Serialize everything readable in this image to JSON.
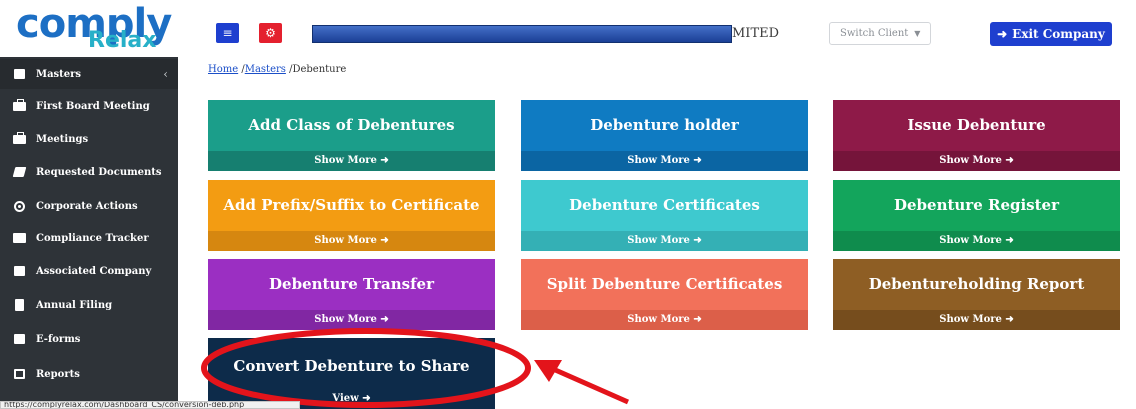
{
  "brand": {
    "logo_main": "comply",
    "logo_sub": "Relax"
  },
  "sidebar": {
    "items": [
      {
        "label": "Masters",
        "icon": "grid-icon",
        "caret": "‹"
      },
      {
        "label": "First Board Meeting",
        "icon": "briefcase-icon"
      },
      {
        "label": "Meetings",
        "icon": "briefcase-icon"
      },
      {
        "label": "Requested Documents",
        "icon": "folder-icon"
      },
      {
        "label": "Corporate Actions",
        "icon": "target-icon"
      },
      {
        "label": "Compliance Tracker",
        "icon": "list-icon"
      },
      {
        "label": "Associated Company",
        "icon": "building-icon"
      },
      {
        "label": "Annual Filing",
        "icon": "file-icon"
      },
      {
        "label": "E-forms",
        "icon": "image-icon"
      },
      {
        "label": "Reports",
        "icon": "edit-icon"
      }
    ]
  },
  "topbar": {
    "menu_icon": "≡",
    "settings_icon": "⚙",
    "company_name_tail": "MITED",
    "switch_client": "Switch Client",
    "exit_label": "Exit Company"
  },
  "breadcrumb": {
    "home": "Home",
    "sep1": " /",
    "masters": "Masters",
    "sep2": " /",
    "current": "Debenture"
  },
  "cards": [
    {
      "title": "Add Class of Debentures",
      "footer": "Show More",
      "color": "#1b9e8a",
      "foot_color": "#167f70"
    },
    {
      "title": "Debenture holder",
      "footer": "Show More",
      "color": "#0f7bc2",
      "foot_color": "#0b65a3"
    },
    {
      "title": "Issue Debenture",
      "footer": "Show More",
      "color": "#8e1a48",
      "foot_color": "#75143a"
    },
    {
      "title": "Add Prefix/Suffix to Certificate",
      "footer": "Show More",
      "color": "#f39c12",
      "foot_color": "#d68710"
    },
    {
      "title": "Debenture Certificates",
      "footer": "Show More",
      "color": "#3ec9cf",
      "foot_color": "#34b0b5"
    },
    {
      "title": "Debenture Register",
      "footer": "Show More",
      "color": "#13a55c",
      "foot_color": "#0f8c4d"
    },
    {
      "title": "Debenture Transfer",
      "footer": "Show More",
      "color": "#9b2fc2",
      "foot_color": "#8127a3"
    },
    {
      "title": "Split Debenture Certificates",
      "footer": "Show More",
      "color": "#f2715a",
      "foot_color": "#dc5f49"
    },
    {
      "title": "Debentureholding Report",
      "footer": "Show More",
      "color": "#8e5e24",
      "foot_color": "#764d1d"
    },
    {
      "title": "Convert Debenture to Share",
      "footer": "View",
      "color": "#0d2b4a",
      "foot_color": "#0d2b4a"
    }
  ],
  "status_url": "https://complyrelax.com/Dashboard_CS/conversion-deb.php",
  "annotation_color": "#e3141b"
}
